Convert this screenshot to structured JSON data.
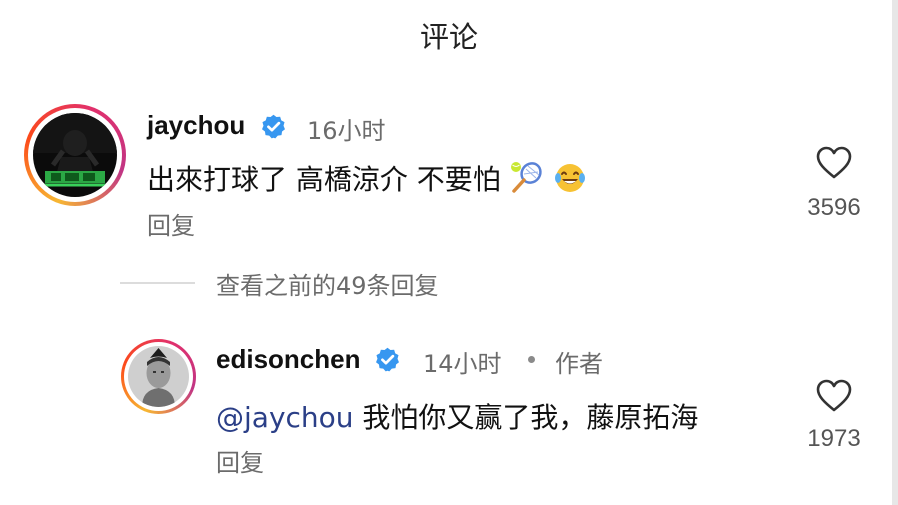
{
  "header": {
    "title": "评论"
  },
  "comments": [
    {
      "username": "jaychou",
      "time": "16小时",
      "text": "出來打球了 高橋涼介 不要怕",
      "emojis": [
        "tennis-racket-icon",
        "laughing-tears-icon"
      ],
      "reply_label": "回复",
      "likes": "3596"
    }
  ],
  "view_previous": "查看之前的49条回复",
  "replies": [
    {
      "username": "edisonchen",
      "time": "14小时",
      "author_label": "作者",
      "mention": "@jaychou",
      "text": " 我怕你又赢了我，藤原拓海",
      "reply_label": "回复",
      "likes": "1973"
    }
  ],
  "colors": {
    "mention": "#2b3f87",
    "verified": "#3797f0",
    "secondary_text": "#6b6b6b"
  }
}
